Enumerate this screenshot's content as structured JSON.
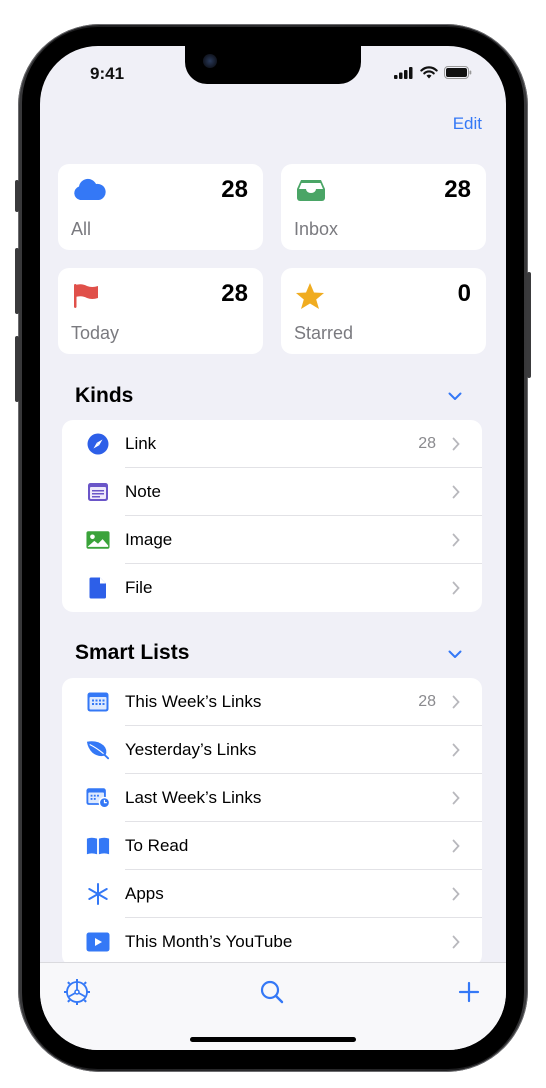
{
  "status_bar": {
    "time": "9:41",
    "icons": [
      "cellular-signal-icon",
      "wifi-icon",
      "battery-icon"
    ]
  },
  "nav": {
    "edit_label": "Edit"
  },
  "tiles": [
    {
      "label": "All",
      "count": "28",
      "icon": "cloud-icon",
      "color": "#3478f6"
    },
    {
      "label": "Inbox",
      "count": "28",
      "icon": "tray-icon",
      "color": "#4aa566"
    },
    {
      "label": "Today",
      "count": "28",
      "icon": "flag-icon",
      "color": "#e0504a"
    },
    {
      "label": "Starred",
      "count": "0",
      "icon": "star-icon",
      "color": "#f0ac20"
    }
  ],
  "kinds": {
    "title": "Kinds",
    "items": [
      {
        "label": "Link",
        "count": "28",
        "icon": "compass-icon",
        "color": "#2d5fe8"
      },
      {
        "label": "Note",
        "count": "",
        "icon": "note-icon",
        "color": "#6a55c8"
      },
      {
        "label": "Image",
        "count": "",
        "icon": "photo-icon",
        "color": "#3aa33a"
      },
      {
        "label": "File",
        "count": "",
        "icon": "document-icon",
        "color": "#2d5fe8"
      }
    ]
  },
  "smart_lists": {
    "title": "Smart Lists",
    "items": [
      {
        "label": "This Week’s Links",
        "count": "28",
        "icon": "calendar-icon",
        "color": "#3478f6"
      },
      {
        "label": "Yesterday’s Links",
        "count": "",
        "icon": "leaf-icon",
        "color": "#3478f6"
      },
      {
        "label": "Last Week’s Links",
        "count": "",
        "icon": "calendar-clock-icon",
        "color": "#3478f6"
      },
      {
        "label": "To Read",
        "count": "",
        "icon": "book-icon",
        "color": "#3478f6"
      },
      {
        "label": "Apps",
        "count": "",
        "icon": "asterisk-icon",
        "color": "#3478f6"
      },
      {
        "label": "This Month’s YouTube",
        "count": "",
        "icon": "play-icon",
        "color": "#3478f6"
      }
    ]
  },
  "toolbar": {
    "items": [
      "settings-gear-icon",
      "search-icon",
      "add-icon"
    ]
  },
  "accent_color": "#3478f6"
}
